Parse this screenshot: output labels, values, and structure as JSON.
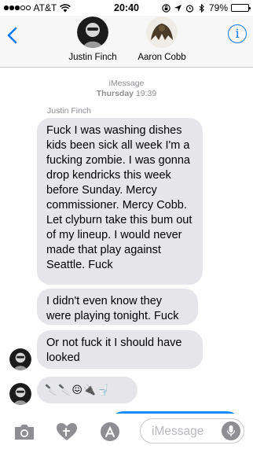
{
  "status_bar": {
    "carrier": "AT&T",
    "signal_bars": 5,
    "signal_filled": 3,
    "time": "20:40",
    "battery_percent_label": "79%",
    "battery_level": 0.79
  },
  "header": {
    "back_icon": "chevron-left-icon",
    "info_label": "i",
    "contacts": [
      {
        "name": "Justin Finch"
      },
      {
        "name": "Aaron Cobb"
      }
    ]
  },
  "conversation": {
    "service": "iMessage",
    "date_day": "Thursday",
    "date_time": "19:39",
    "sender": "Justin Finch",
    "messages": [
      {
        "text": "Fuck I was washing dishes kids been sick all week I'm a fucking zombie. I was gonna drop kendricks this week before Sunday. Mercy commissioner. Mercy Cobb. Let clyburn take this bum out of my lineup. I would never made that play against Seattle. Fuck"
      },
      {
        "text": "I didn't even know they were playing tonight. Fuck"
      },
      {
        "text": "Or not fuck it I should have looked"
      },
      {
        "text": "🔪🔪😖🔌🚽"
      }
    ]
  },
  "input_bar": {
    "placeholder": "iMessage",
    "icons": [
      "camera-icon",
      "digital-touch-icon",
      "app-store-icon",
      "microphone-icon"
    ]
  },
  "colors": {
    "accent": "#0a7aff",
    "incoming_bubble": "#e5e5ea",
    "outgoing_bubble": "#1a8cff",
    "meta_text": "#8e8e93"
  }
}
